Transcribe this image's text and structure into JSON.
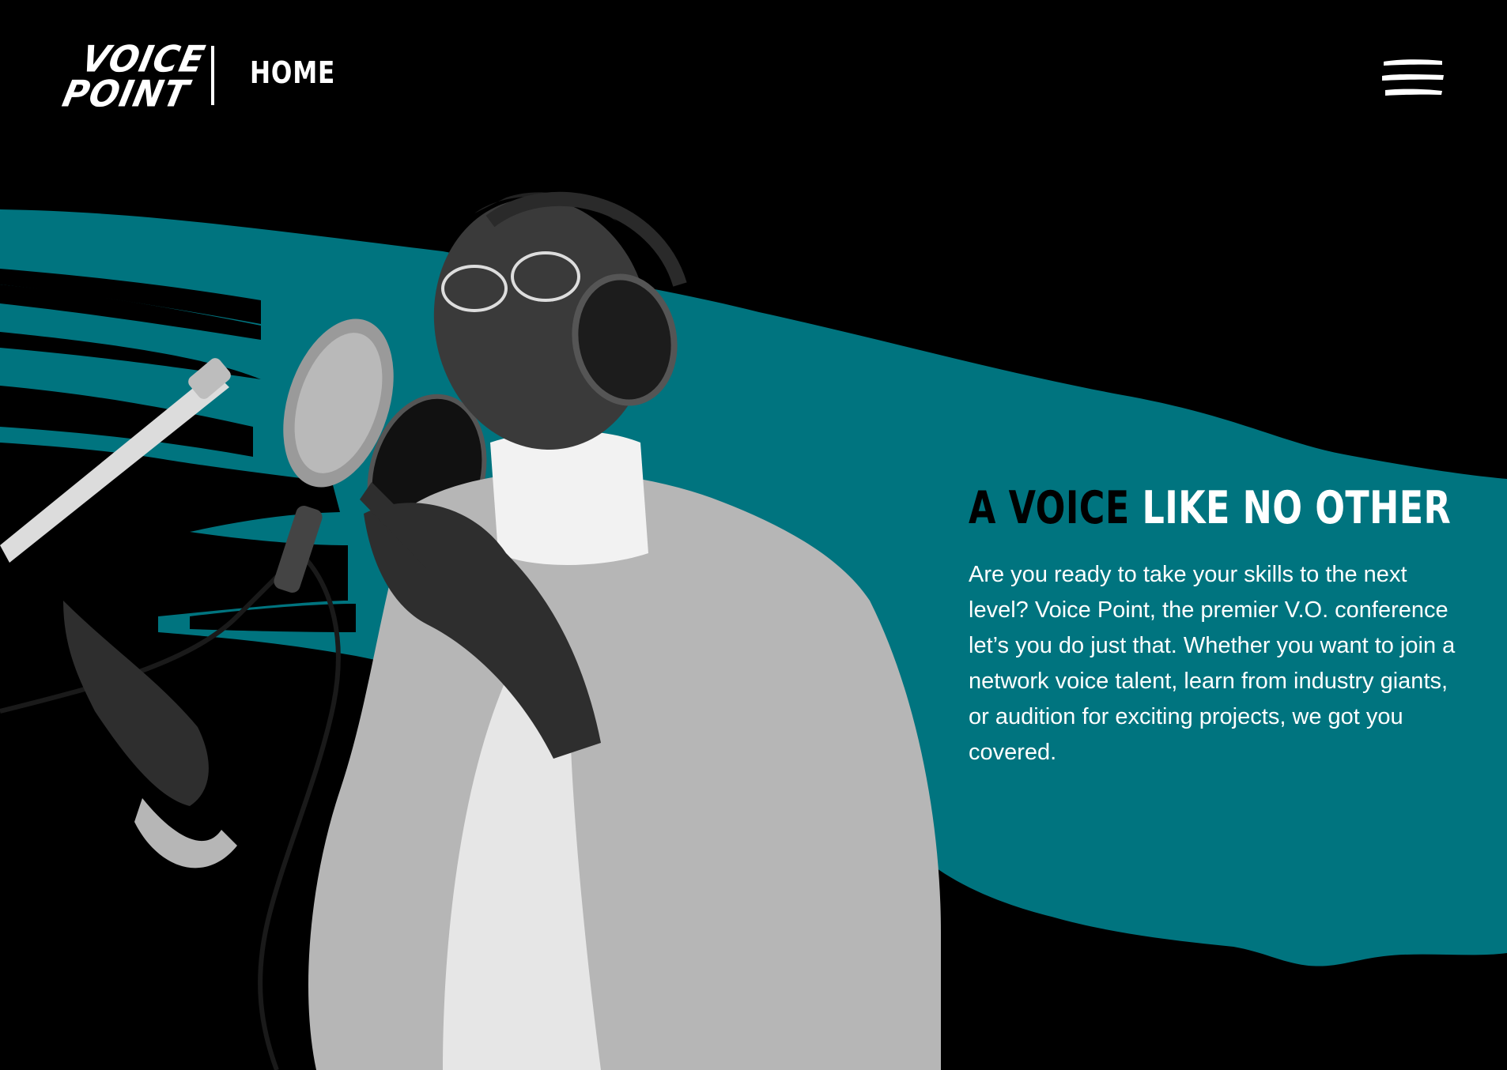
{
  "brand": {
    "logo_line1": "VOICE",
    "logo_line2": "POINT",
    "teal_color": "#00747f",
    "background_color": "#000000",
    "text_color": "#ffffff"
  },
  "nav": {
    "current_page": "HOME",
    "menu_icon": "hamburger-menu-icon"
  },
  "hero": {
    "photo_description_icon": "singer-photo",
    "title_part1": "A VOICE",
    "title_part2": "LIKE NO OTHER",
    "body": "Are you ready to take your skills to the next level? Voice Point, the premier V.O. conference let’s you do just that. Whether you want to join a network voice talent, learn from industry giants, or audition for exciting projects, we got you covered."
  }
}
